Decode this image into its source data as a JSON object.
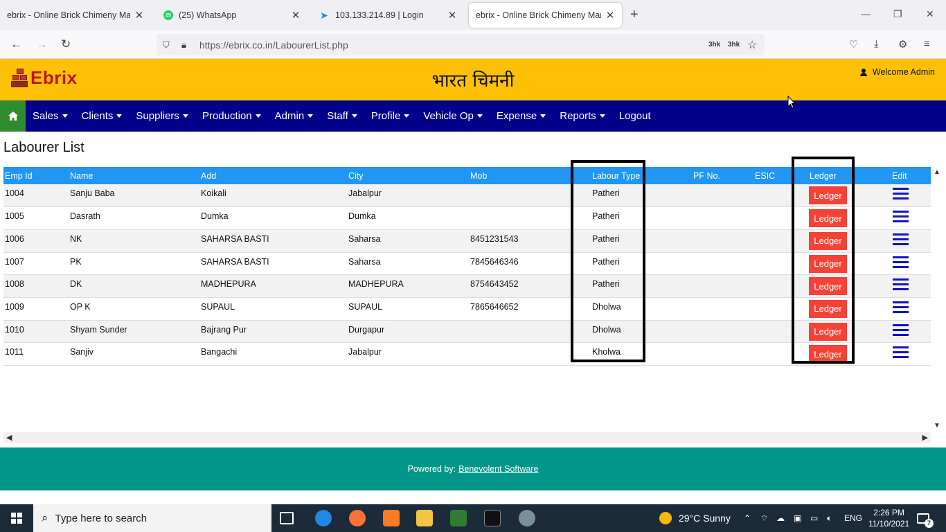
{
  "browser": {
    "tabs": [
      {
        "title": "ebrix - Online Brick Chimeny Manag",
        "active": false
      },
      {
        "title": "(25) WhatsApp",
        "badge": "25",
        "active": false
      },
      {
        "title": "103.133.214.89 | Login",
        "active": false
      },
      {
        "title": "ebrix - Online Brick Chimeny Manag",
        "active": true
      }
    ],
    "url": "https://ebrix.co.in/LabourerList.php",
    "ext_badge_1": "3hk",
    "ext_badge_2": "3hk"
  },
  "header": {
    "logo_text": "Ebrix",
    "brand_title": "भारत चिमनी",
    "welcome": "Welcome Admin"
  },
  "menu": [
    {
      "label": "Sales",
      "dropdown": true
    },
    {
      "label": "Clients",
      "dropdown": true
    },
    {
      "label": "Suppliers",
      "dropdown": true
    },
    {
      "label": "Production",
      "dropdown": true
    },
    {
      "label": "Admin",
      "dropdown": true
    },
    {
      "label": "Staff",
      "dropdown": true
    },
    {
      "label": "Profile",
      "dropdown": true
    },
    {
      "label": "Vehicle Op",
      "dropdown": true
    },
    {
      "label": "Expense",
      "dropdown": true
    },
    {
      "label": "Reports",
      "dropdown": true
    },
    {
      "label": "Logout",
      "dropdown": false
    }
  ],
  "page": {
    "title": "Labourer List",
    "columns": [
      "Emp Id",
      "Name",
      "Add",
      "City",
      "Mob",
      "Labour Type",
      "PF No.",
      "ESIC",
      "Ledger",
      "Edit"
    ],
    "ledger_label": "Ledger",
    "rows": [
      {
        "id": "1004",
        "name": "Sanju Baba",
        "add": "Koikali",
        "city": "Jabalpur",
        "mob": "",
        "type": "Patheri",
        "pf": "",
        "esic": ""
      },
      {
        "id": "1005",
        "name": "Dasrath",
        "add": "Dumka",
        "city": "Dumka",
        "mob": "",
        "type": "Patheri",
        "pf": "",
        "esic": ""
      },
      {
        "id": "1006",
        "name": "NK",
        "add": "SAHARSA BASTI",
        "city": "Saharsa",
        "mob": "8451231543",
        "type": "Patheri",
        "pf": "",
        "esic": ""
      },
      {
        "id": "1007",
        "name": "PK",
        "add": "SAHARSA BASTI",
        "city": "Saharsa",
        "mob": "7845646346",
        "type": "Patheri",
        "pf": "",
        "esic": ""
      },
      {
        "id": "1008",
        "name": "DK",
        "add": "MADHEPURA",
        "city": "MADHEPURA",
        "mob": "8754643452",
        "type": "Patheri",
        "pf": "",
        "esic": ""
      },
      {
        "id": "1009",
        "name": "OP K",
        "add": "SUPAUL",
        "city": "SUPAUL",
        "mob": "7865646652",
        "type": "Dholwa",
        "pf": "",
        "esic": ""
      },
      {
        "id": "1010",
        "name": "Shyam Sunder",
        "add": "Bajrang Pur",
        "city": "Durgapur",
        "mob": "",
        "type": "Dholwa",
        "pf": "",
        "esic": ""
      },
      {
        "id": "1011",
        "name": "Sanjiv",
        "add": "Bangachi",
        "city": "Jabalpur",
        "mob": "",
        "type": "Kholwa",
        "pf": "",
        "esic": ""
      }
    ]
  },
  "footer": {
    "powered_by": "Powered by:",
    "company": "Benevolent Software"
  },
  "taskbar": {
    "search_placeholder": "Type here to search",
    "weather": "29°C  Sunny",
    "language": "ENG",
    "time": "2:26 PM",
    "date": "11/10/2021",
    "notification_count": "7"
  },
  "colors": {
    "header_bg": "#ffc107",
    "menu_bg": "#01018a",
    "table_header": "#2196f3",
    "ledger_button": "#f44336",
    "footer_bg": "#009688"
  }
}
